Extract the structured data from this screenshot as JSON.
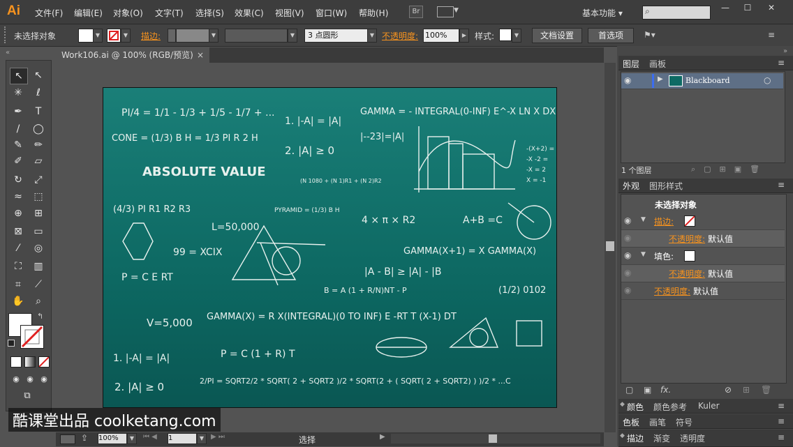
{
  "app": {
    "logo": "Ai",
    "workspace": "基本功能 ▾",
    "br": "Br"
  },
  "menus": [
    "文件(F)",
    "编辑(E)",
    "对象(O)",
    "文字(T)",
    "选择(S)",
    "效果(C)",
    "视图(V)",
    "窗口(W)",
    "帮助(H)"
  ],
  "control": {
    "no_selection": "未选择对象",
    "stroke_label": "描边:",
    "point_value": "3 点圆形",
    "opacity_label": "不透明度:",
    "opacity_value": "100%",
    "style_label": "样式:",
    "doc_setup": "文档设置",
    "prefs": "首选项"
  },
  "document": {
    "tab_title": "Work106.ai @ 100% (RGB/预览)"
  },
  "layers_panel": {
    "tab_layers": "图层",
    "tab_artboards": "画板",
    "layer_name": "Blackboard",
    "count": "1 个图层"
  },
  "appearance_panel": {
    "tab_appearance": "外观",
    "tab_styles": "图形样式",
    "header": "未选择对象",
    "stroke_label": "描边:",
    "opacity_label": "不透明度:",
    "opacity_value": "默认值",
    "fill_label": "填色:",
    "fx": "fx."
  },
  "bottom_panels": [
    {
      "tabs": [
        "颜色",
        "颜色参考",
        "Kuler"
      ]
    },
    {
      "tabs": [
        "色板",
        "画笔",
        "符号"
      ]
    },
    {
      "tabs": [
        "描边",
        "渐变",
        "透明度"
      ]
    }
  ],
  "status": {
    "zoom": "100%",
    "page": "1",
    "tool": "选择"
  },
  "watermark": "酷课堂出品 coolketang.com",
  "chalk": {
    "l1": "PI/4 = 1/1 - 1/3 + 1/5 - 1/7 + ...",
    "l2": "CONE = (1/3) B H = 1/3 PI R 2 H",
    "l3": "ABSOLUTE VALUE",
    "l4": "(4/3) PI R1 R2 R3",
    "l5": "L=50,000",
    "l6": "99 = XCIX",
    "l7": "P = C E RT",
    "l8": "V=5,000",
    "l9": "1. |-A| = |A|",
    "l10": "2. |A| ≥ 0",
    "l11": "P = C (1 + R) T",
    "l12": "2/PI = SQRT2/2 * SQRT( 2 + SQRT2 )/2 * SQRT(2 + ( SQRT( 2 + SQRT2) ) )/2 * ...C",
    "l13": "GAMMA(X) = R X(INTEGRAL)(0 TO INF) E -RT T (X-1) DT",
    "l14": "GAMMA = - INTEGRAL(0-INF) E^-X LN X DX",
    "l15": "|--23|=|A|",
    "l16": "(N 1080 + (N 1)R1 + (N 2)R2",
    "l17": "PYRAMID = (1/3) B H",
    "l18": "4 × π × R2",
    "l19": "A+B =C",
    "l20": "GAMMA(X+1) = X GAMMA(X)",
    "l21": "|A - B| ≥ |A| - |B",
    "l22": "B = A (1 + R/N)NT - P",
    "l23": "(1/2) 0102",
    "l24": "1. |-A| = |A|",
    "l25": "2. |A| ≥ 0",
    "l26": "-(X+2) =",
    "l27": "-X -2 =",
    "l28": "-X = 2",
    "l29": "X = -1"
  }
}
